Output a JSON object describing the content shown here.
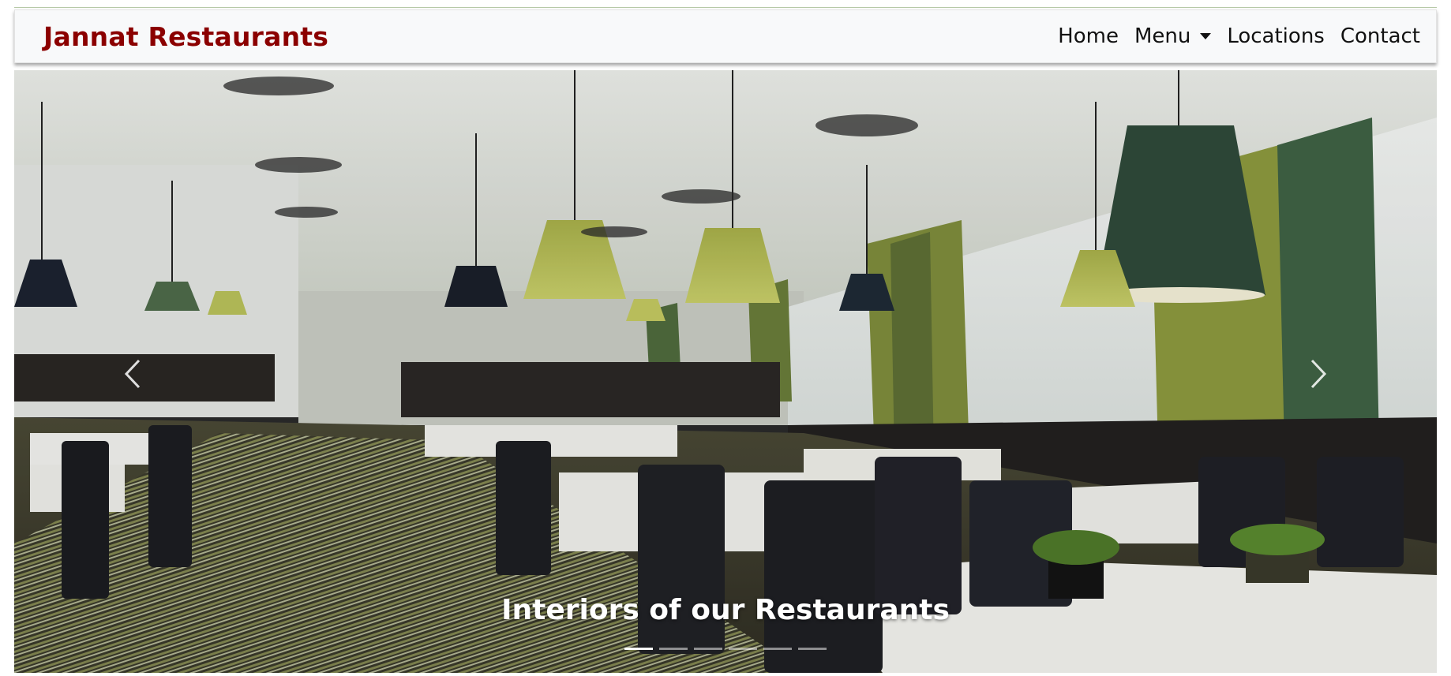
{
  "brand": "Jannat Restaurants",
  "nav": {
    "home": "Home",
    "menu": "Menu",
    "locations": "Locations",
    "contact": "Contact"
  },
  "carousel": {
    "caption": "Interiors of our Restaurants",
    "indicator_count": 6,
    "active_index": 0,
    "prev_icon": "chevron-left-icon",
    "next_icon": "chevron-right-icon"
  },
  "colors": {
    "brand": "#8b0000",
    "navbar_bg": "#f8f9fa"
  }
}
